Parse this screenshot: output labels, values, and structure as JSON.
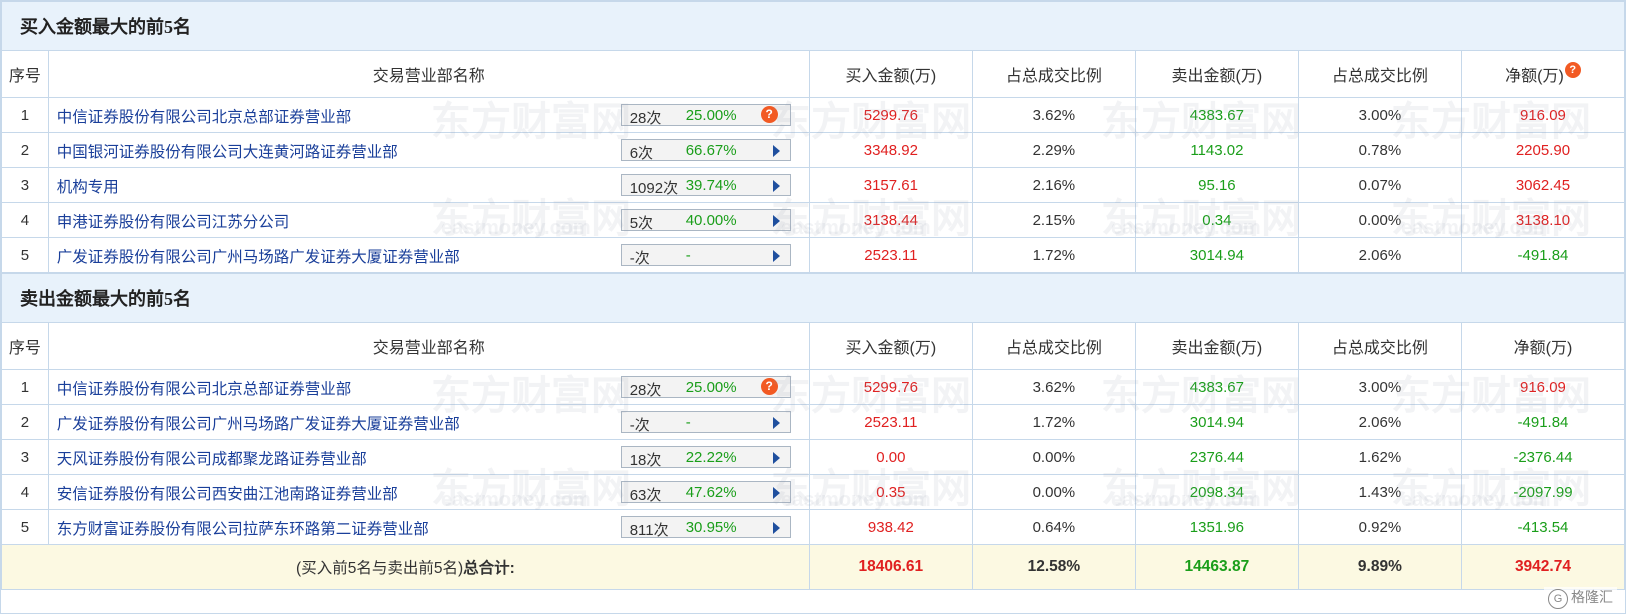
{
  "buy_section": {
    "title": "买入金额最大的前5名",
    "headers": [
      "序号",
      "交易营业部名称",
      "买入金额(万)",
      "占总成交比例",
      "卖出金额(万)",
      "占总成交比例",
      "净额(万)"
    ],
    "rows": [
      {
        "idx": "1",
        "name": "中信证券股份有限公司北京总部证券营业部",
        "count": "28次",
        "pct": "25.00%",
        "icon": "question-icon",
        "buy": "5299.76",
        "buy_ratio": "3.62%",
        "sell": "4383.67",
        "sell_ratio": "3.00%",
        "net": "916.09"
      },
      {
        "idx": "2",
        "name": "中国银河证券股份有限公司大连黄河路证券营业部",
        "count": "6次",
        "pct": "66.67%",
        "icon": "arrow-icon",
        "buy": "3348.92",
        "buy_ratio": "2.29%",
        "sell": "1143.02",
        "sell_ratio": "0.78%",
        "net": "2205.90"
      },
      {
        "idx": "3",
        "name": "机构专用",
        "count": "1092次",
        "pct": "39.74%",
        "icon": "arrow-icon",
        "buy": "3157.61",
        "buy_ratio": "2.16%",
        "sell": "95.16",
        "sell_ratio": "0.07%",
        "net": "3062.45"
      },
      {
        "idx": "4",
        "name": "申港证券股份有限公司江苏分公司",
        "count": "5次",
        "pct": "40.00%",
        "icon": "arrow-icon",
        "buy": "3138.44",
        "buy_ratio": "2.15%",
        "sell": "0.34",
        "sell_ratio": "0.00%",
        "net": "3138.10"
      },
      {
        "idx": "5",
        "name": "广发证券股份有限公司广州马场路广发证券大厦证券营业部",
        "count": "-次",
        "pct": "-",
        "icon": "arrow-icon",
        "buy": "2523.11",
        "buy_ratio": "1.72%",
        "sell": "3014.94",
        "sell_ratio": "2.06%",
        "net": "-491.84"
      }
    ]
  },
  "sell_section": {
    "title": "卖出金额最大的前5名",
    "headers": [
      "序号",
      "交易营业部名称",
      "买入金额(万)",
      "占总成交比例",
      "卖出金额(万)",
      "占总成交比例",
      "净额(万)"
    ],
    "rows": [
      {
        "idx": "1",
        "name": "中信证券股份有限公司北京总部证券营业部",
        "count": "28次",
        "pct": "25.00%",
        "icon": "question-icon",
        "buy": "5299.76",
        "buy_ratio": "3.62%",
        "sell": "4383.67",
        "sell_ratio": "3.00%",
        "net": "916.09"
      },
      {
        "idx": "2",
        "name": "广发证券股份有限公司广州马场路广发证券大厦证券营业部",
        "count": "-次",
        "pct": "-",
        "icon": "arrow-icon",
        "buy": "2523.11",
        "buy_ratio": "1.72%",
        "sell": "3014.94",
        "sell_ratio": "2.06%",
        "net": "-491.84"
      },
      {
        "idx": "3",
        "name": "天风证券股份有限公司成都聚龙路证券营业部",
        "count": "18次",
        "pct": "22.22%",
        "icon": "arrow-icon",
        "buy": "0.00",
        "buy_ratio": "0.00%",
        "sell": "2376.44",
        "sell_ratio": "1.62%",
        "net": "-2376.44"
      },
      {
        "idx": "4",
        "name": "安信证券股份有限公司西安曲江池南路证券营业部",
        "count": "63次",
        "pct": "47.62%",
        "icon": "arrow-icon",
        "buy": "0.35",
        "buy_ratio": "0.00%",
        "sell": "2098.34",
        "sell_ratio": "1.43%",
        "net": "-2097.99"
      },
      {
        "idx": "5",
        "name": "东方财富证券股份有限公司拉萨东环路第二证券营业部",
        "count": "811次",
        "pct": "30.95%",
        "icon": "arrow-icon",
        "buy": "938.42",
        "buy_ratio": "0.64%",
        "sell": "1351.96",
        "sell_ratio": "0.92%",
        "net": "-413.54"
      }
    ]
  },
  "total": {
    "label_prefix": "(买入前5名与卖出前5名)",
    "label_bold": "总合计:",
    "buy": "18406.61",
    "buy_ratio": "12.58%",
    "sell": "14463.87",
    "sell_ratio": "9.89%",
    "net": "3942.74"
  },
  "header_help_glyph": "?",
  "watermark": {
    "cn": "东方财富网",
    "en": "eastmoney.com"
  },
  "corner_logo": {
    "text": "格隆汇"
  },
  "colors": {
    "buy": "#e02020",
    "sell": "#1a9e1a",
    "link": "#1a3f9a",
    "header_bg": "#e8f2fb",
    "total_bg": "#fcf9e2",
    "border": "#c6d8ea",
    "badge_arrow": "#1f4f9e",
    "help_icon": "#f25a23"
  }
}
